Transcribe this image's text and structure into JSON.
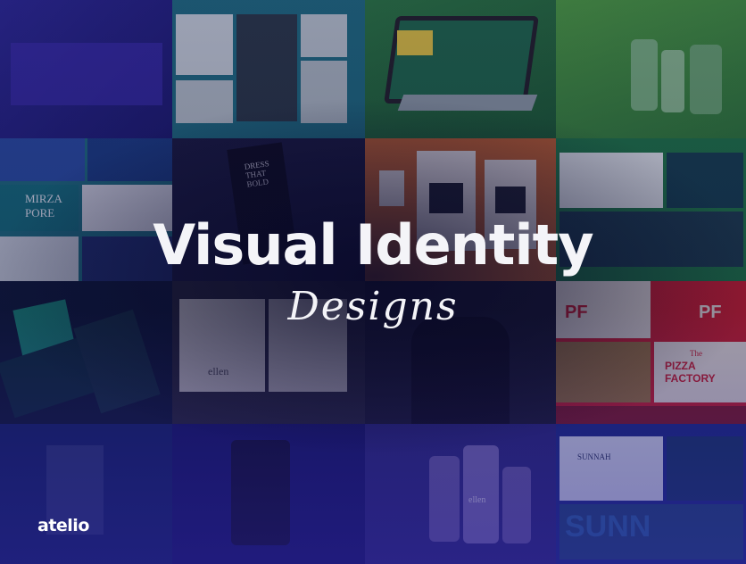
{
  "hero": {
    "title": "Visual Identity",
    "subtitle": "Designs"
  },
  "brand": {
    "logo": "atelio"
  },
  "mockups": {
    "mirza": "MIRZA",
    "pore": "PORE",
    "pf": "PF",
    "pizza_the": "The",
    "pizza_name": "PIZZA FACTORY",
    "sunnah": "SUNNAH",
    "sunn": "SUNN",
    "ellen": "ellen",
    "dress": "DRESS THAT BOLD"
  },
  "colors": {
    "accent_green": "#3a9b3c",
    "accent_purple": "#3b2bbf",
    "pizza_red": "#d4202a",
    "teal": "#1f8b8f"
  }
}
